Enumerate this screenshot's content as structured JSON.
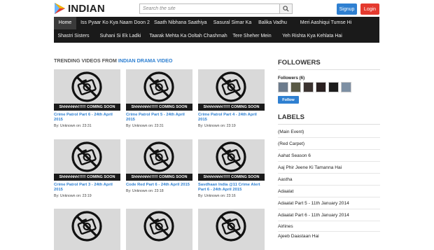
{
  "header": {
    "logo_text": "INDIAN",
    "search_placeholder": "Search the site",
    "signup_label": "Signup",
    "login_label": "Login",
    "accent": "#2f80d1",
    "login_color": "#e43a2f"
  },
  "nav": {
    "items": [
      {
        "label": "Home"
      },
      {
        "label": "Iss Pyaar Ko Kya Naam Doon 2"
      },
      {
        "label": "Saath Nibhana Saathiya"
      },
      {
        "label": "Sasural Simar Ka"
      },
      {
        "label": "Balika Vadhu"
      },
      {
        "label": "Meri Aashiqui Tumse Hi"
      },
      {
        "label": "Shastri Sisters"
      },
      {
        "label": "Suhani Si Ek Ladki"
      },
      {
        "label": "Taarak Mehta Ka Ooltah Chashmah"
      },
      {
        "label": "Tere Sheher Mein"
      },
      {
        "label": "Yeh Rishta Kya Kehlata Hai"
      }
    ]
  },
  "main": {
    "section_prefix": "TRENDING VIDEOS FROM",
    "section_highlight": "INDIAN DRAMA VIDEO",
    "thumb_banner": "Shhhhhhh!!!!!! COMING SOON",
    "videos": [
      {
        "title": "Crime Patrol Part 6 - 24th April 2015",
        "meta": "By: Unknown on: 23:31"
      },
      {
        "title": "Crime Patrol Part 5 - 24th April 2015",
        "meta": "By: Unknown on: 23:31"
      },
      {
        "title": "Crime Patrol Part 4 - 24th April 2015",
        "meta": "By: Unknown on: 23:19"
      },
      {
        "title": "Crime Patrol Part 3 - 24th April 2015",
        "meta": "By: Unknown on: 23:19"
      },
      {
        "title": "Code Red Part 6 - 24th April 2015",
        "meta": "By: Unknown on: 23:18"
      },
      {
        "title": "Savdhaan India @11 Crime Alert Part 6 - 24th April 2015",
        "meta": "By: Unknown on: 23:16"
      }
    ]
  },
  "sidebar": {
    "followers_heading": "FOLLOWERS",
    "followers_label": "Followers (6)",
    "follow_label": "Follow",
    "labels_heading": "LABELS",
    "labels": [
      "(Main Event)",
      "(Red Carpet)",
      "Aahat Season 6",
      "Aaj Phir Jeene Ki Tamanna Hai",
      "Aastha",
      "Adaalat",
      "Adaalat Part 5 - 11th January 2014",
      "Adaalat Part 6 - 11th January 2014",
      "Airlines",
      "Ajeeb Daastaan Hai"
    ]
  }
}
